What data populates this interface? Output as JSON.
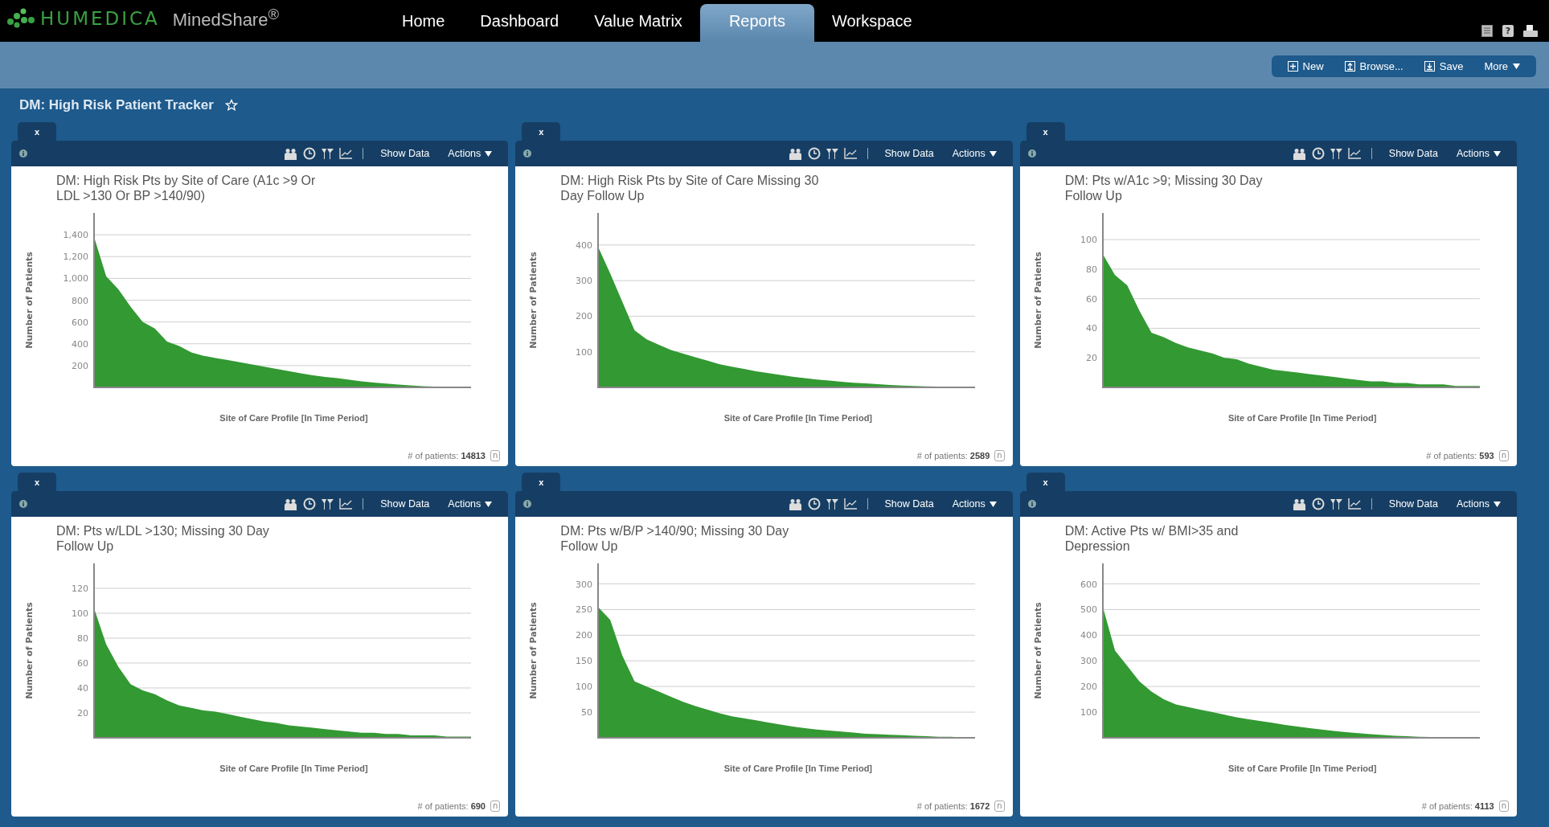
{
  "app": {
    "brand": "HUMEDICA",
    "product": "MinedShare$^{®}$"
  },
  "nav_tabs": [
    {
      "label": "Home",
      "selected": false
    },
    {
      "label": "Dashboard",
      "selected": false
    },
    {
      "label": "Value Matrix",
      "selected": false
    },
    {
      "label": "Reports",
      "selected": true
    },
    {
      "label": "Workspace",
      "selected": false
    }
  ],
  "utility": {
    "help_label": "?"
  },
  "toolbar": [
    {
      "label": "New",
      "kind": "new"
    },
    {
      "label": "Browse...",
      "kind": "browse"
    },
    {
      "label": "Save",
      "kind": "save"
    },
    {
      "label": "More",
      "kind": "menu"
    }
  ],
  "page_title": "DM: High Risk Patient Tracker",
  "favorite": false,
  "panels": [
    {
      "close_label": "x",
      "show_data": "Show Data",
      "actions": "Actions",
      "title_lines": [
        "DM: High Risk Pts by Site of Care (A1c >9 Or",
        "LDL >130 Or BP >140/90)"
      ],
      "footer": "# of patients: **14813**",
      "footer_badge": "n",
      "chart_data": {
        "type": "area",
        "ylabel": "Number of Patients",
        "xlabel": "Site of Care Profile [In Time Period]",
        "grid": true,
        "ylim": [
          0,
          1600
        ],
        "yticks": [
          {
            "value": 200,
            "label": "200"
          },
          {
            "value": 400,
            "label": "400"
          },
          {
            "value": 600,
            "label": "600"
          },
          {
            "value": 800,
            "label": "800"
          },
          {
            "value": 1000,
            "label": "1,000"
          },
          {
            "value": 1200,
            "label": "1,200"
          },
          {
            "value": 1400,
            "label": "1,400"
          }
        ],
        "series": [
          {
            "color": "#339933",
            "values": [
              1380,
              1020,
              900,
              740,
              600,
              540,
              420,
              380,
              320,
              290,
              270,
              250,
              230,
              210,
              190,
              170,
              150,
              130,
              110,
              95,
              85,
              70,
              55,
              45,
              35,
              25,
              18,
              12,
              8,
              5,
              3,
              1
            ]
          }
        ]
      }
    },
    {
      "close_label": "x",
      "show_data": "Show Data",
      "actions": "Actions",
      "title_lines": [
        "DM: High Risk Pts by Site of Care Missing 30",
        "Day Follow Up"
      ],
      "footer": "# of patients: **2589**",
      "footer_badge": "n",
      "chart_data": {
        "type": "area",
        "ylabel": "Number of Patients",
        "xlabel": "Site of Care Profile [In Time Period]",
        "grid": true,
        "ylim": [
          0,
          490
        ],
        "yticks": [
          100,
          200,
          300,
          400
        ],
        "series": [
          {
            "color": "#339933",
            "values": [
              395,
              320,
              240,
              160,
              135,
              120,
              105,
              95,
              85,
              75,
              65,
              58,
              52,
              45,
              40,
              35,
              30,
              26,
              22,
              19,
              16,
              13,
              11,
              9,
              7,
              5,
              4,
              3,
              2,
              1,
              1,
              1
            ]
          }
        ]
      }
    },
    {
      "close_label": "x",
      "show_data": "Show Data",
      "actions": "Actions",
      "title_lines": [
        "DM: Pts w/A1c >9; Missing 30 Day",
        "Follow Up"
      ],
      "footer": "# of patients: **593**",
      "footer_badge": "n",
      "chart_data": {
        "type": "area",
        "ylabel": "Number of Patients",
        "xlabel": "Site of Care Profile [In Time Period]",
        "grid": true,
        "ylim": [
          0,
          118
        ],
        "yticks": [
          20,
          40,
          60,
          80,
          100
        ],
        "series": [
          {
            "color": "#339933",
            "values": [
              90,
              76,
              69,
              52,
              37,
              34,
              30,
              27,
              25,
              23,
              20,
              19,
              16,
              14,
              12,
              11,
              10,
              9,
              8,
              7,
              6,
              5,
              4,
              4,
              3,
              3,
              2,
              2,
              2,
              1,
              1,
              1
            ]
          }
        ]
      }
    },
    {
      "close_label": "x",
      "show_data": "Show Data",
      "actions": "Actions",
      "title_lines": [
        "DM: Pts w/LDL >130; Missing 30 Day",
        "Follow Up"
      ],
      "footer": "# of patients: **690**",
      "footer_badge": "n",
      "chart_data": {
        "type": "area",
        "ylabel": "Number of Patients",
        "xlabel": "Site of Care Profile [In Time Period]",
        "grid": true,
        "ylim": [
          0,
          140
        ],
        "yticks": [
          20,
          40,
          60,
          80,
          100,
          120
        ],
        "series": [
          {
            "color": "#339933",
            "values": [
              104,
              75,
              57,
              43,
              38,
              35,
              30,
              26,
              24,
              22,
              21,
              19,
              17,
              15,
              13,
              12,
              10,
              9,
              8,
              7,
              6,
              5,
              4,
              4,
              3,
              3,
              2,
              2,
              2,
              1,
              1,
              1
            ]
          }
        ]
      }
    },
    {
      "close_label": "x",
      "show_data": "Show Data",
      "actions": "Actions",
      "title_lines": [
        "DM: Pts w/B/P >140/90; Missing 30 Day",
        "Follow Up"
      ],
      "footer": "# of patients: **1672**",
      "footer_badge": "n",
      "chart_data": {
        "type": "area",
        "ylabel": "Number of Patients",
        "xlabel": "Site of Care Profile [In Time Period]",
        "grid": true,
        "ylim": [
          0,
          340
        ],
        "yticks": [
          50,
          100,
          150,
          200,
          250,
          300
        ],
        "series": [
          {
            "color": "#339933",
            "values": [
              255,
              230,
              160,
              110,
              100,
              90,
              80,
              70,
              62,
              55,
              48,
              42,
              38,
              34,
              30,
              26,
              22,
              19,
              16,
              14,
              12,
              10,
              8,
              7,
              6,
              5,
              4,
              3,
              2,
              2,
              1,
              1
            ]
          }
        ]
      }
    },
    {
      "close_label": "x",
      "show_data": "Show Data",
      "actions": "Actions",
      "title_lines": [
        "DM: Active Pts w/ BMI>35 and",
        "Depression"
      ],
      "footer": "# of patients: **4113**",
      "footer_badge": "n",
      "chart_data": {
        "type": "area",
        "ylabel": "Number of Patients",
        "xlabel": "Site of Care Profile [In Time Period]",
        "grid": true,
        "ylim": [
          0,
          680
        ],
        "yticks": [
          100,
          200,
          300,
          400,
          500,
          600
        ],
        "series": [
          {
            "color": "#339933",
            "values": [
              510,
              340,
              280,
              220,
              180,
              150,
              130,
              120,
              110,
              100,
              90,
              80,
              72,
              65,
              58,
              50,
              44,
              38,
              32,
              27,
              22,
              18,
              14,
              11,
              8,
              6,
              4,
              3,
              2,
              2,
              1,
              1
            ]
          }
        ]
      }
    }
  ]
}
